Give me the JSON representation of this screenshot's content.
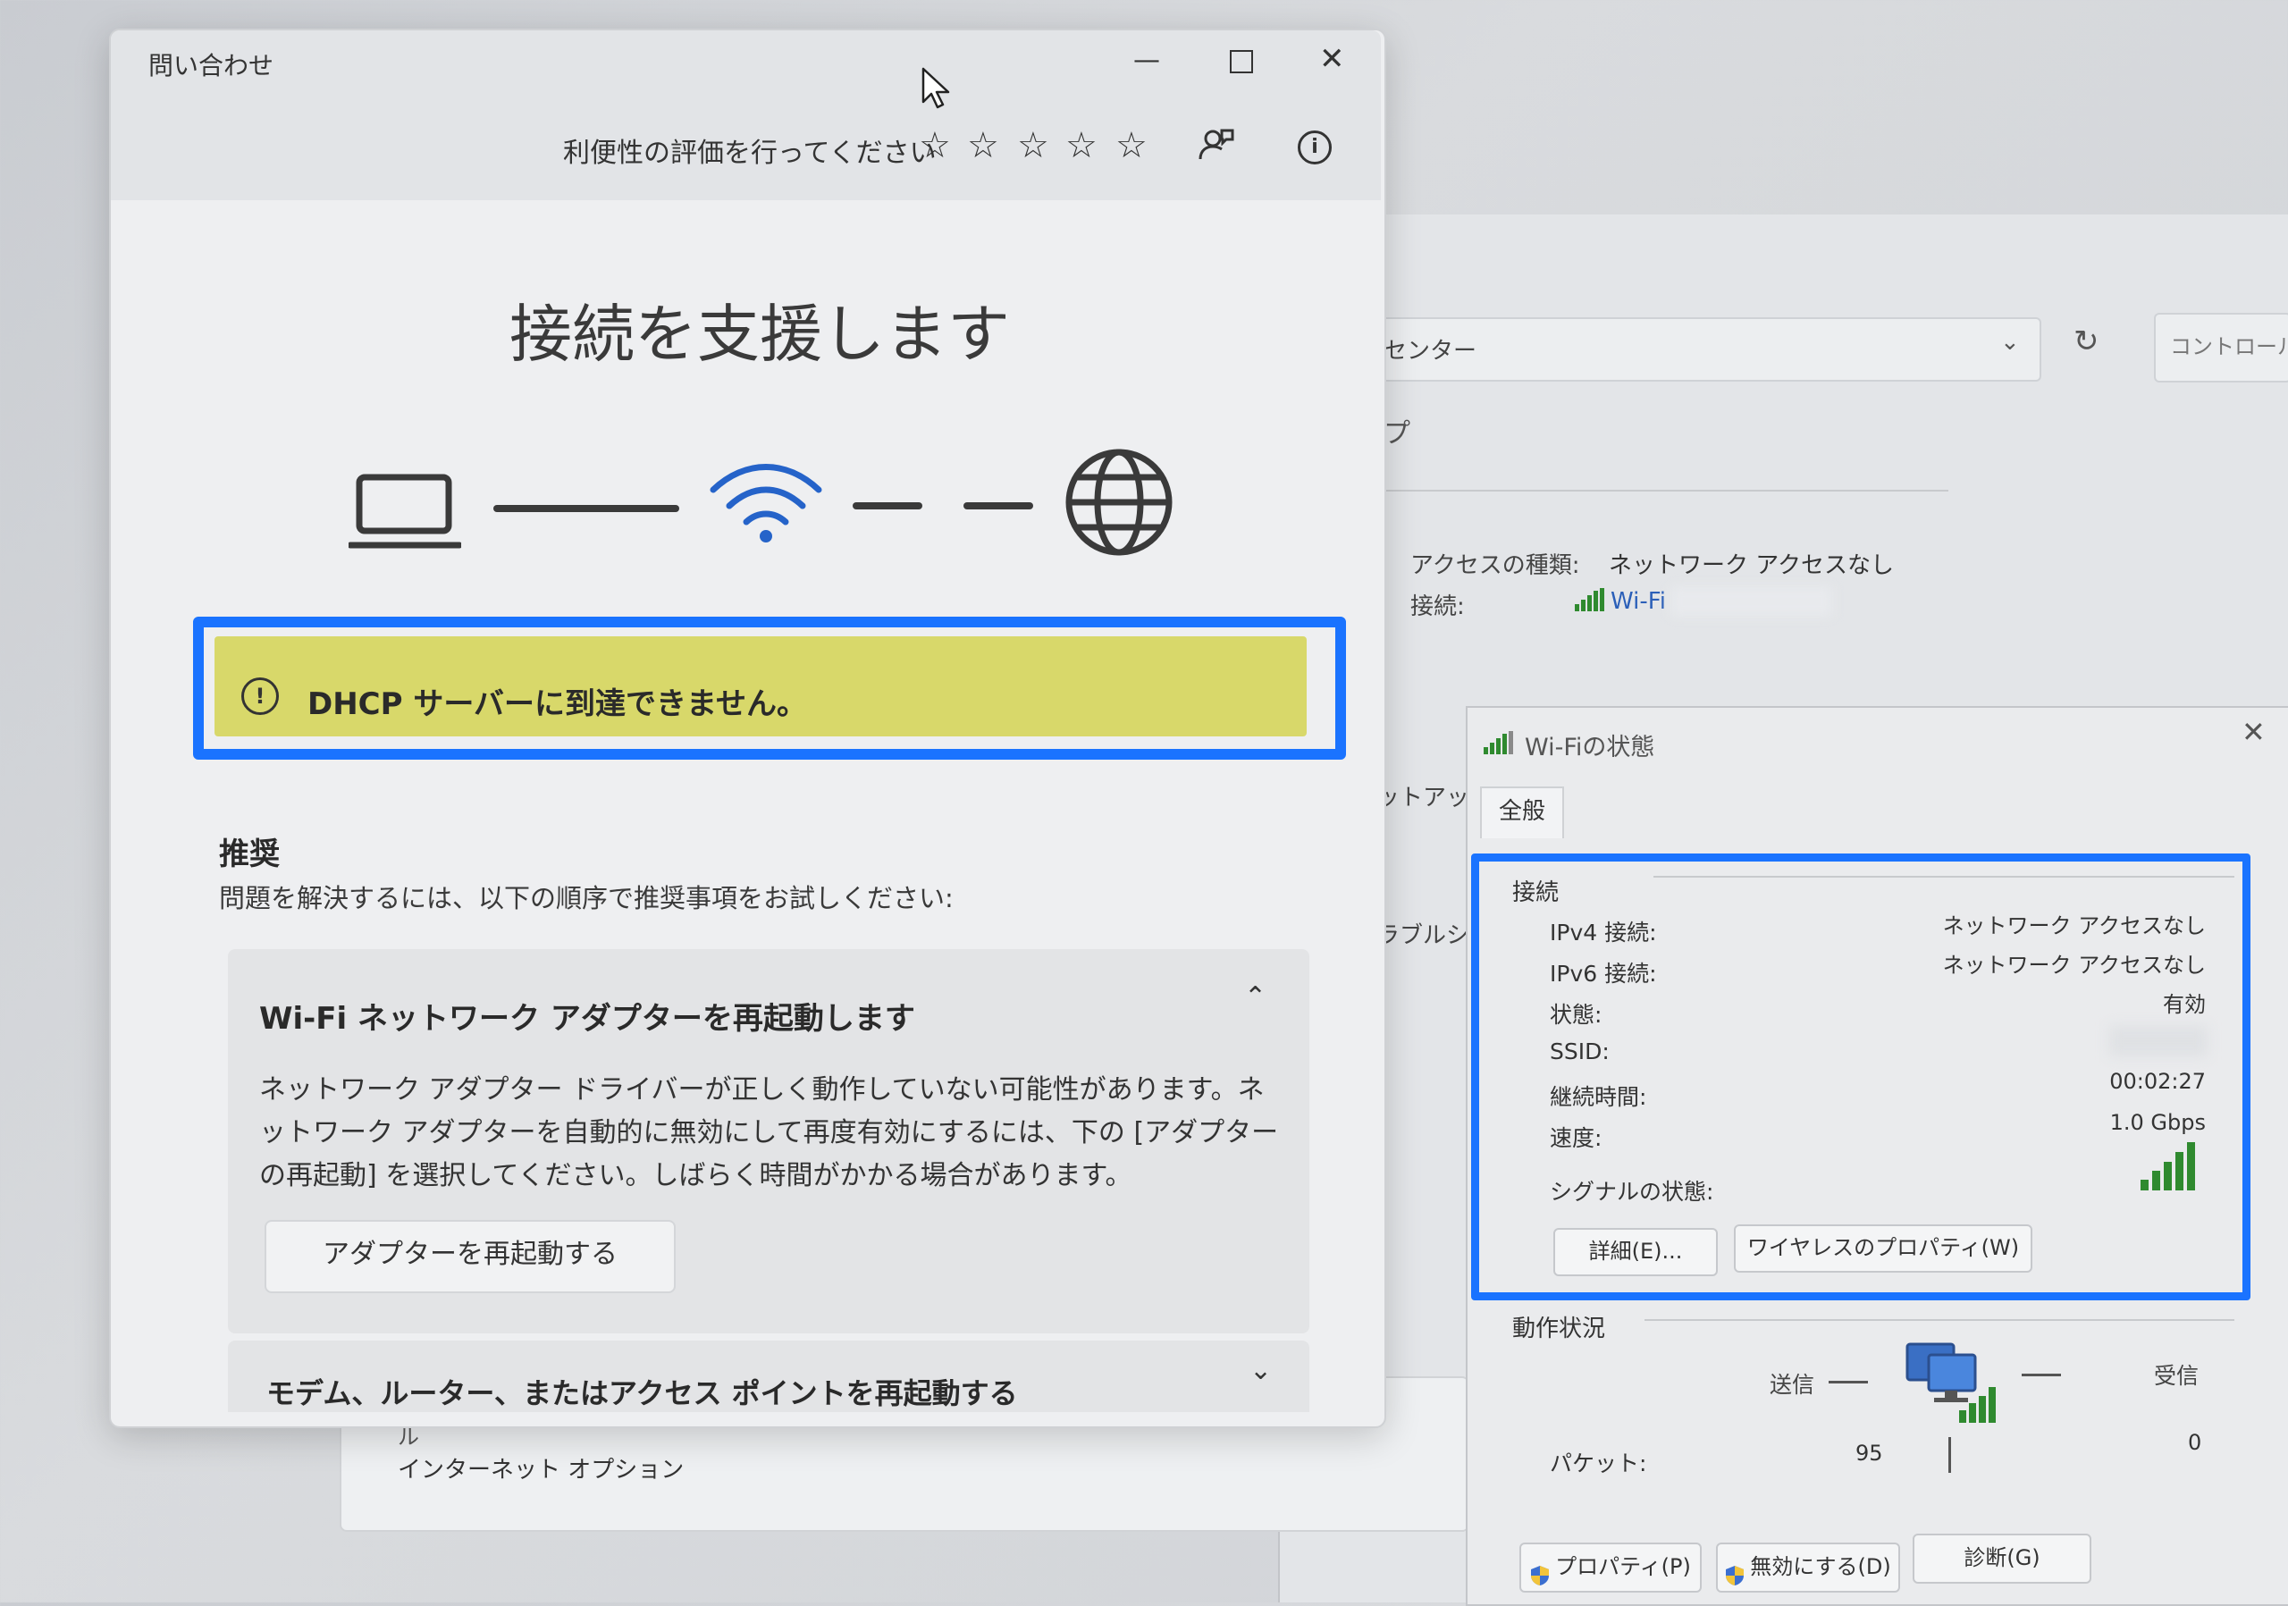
{
  "background_window": {
    "address_text": "センター",
    "search_placeholder": "コントロール パ",
    "heading_fragment": "プ",
    "access_type_label": "アクセスの種類:",
    "access_type_value": "ネットワーク アクセスなし",
    "connection_label": "接続:",
    "connection_value": "Wi-Fi",
    "setup_fragment": "ットアップ",
    "troubleshoot_fragment": "ラブルシュ",
    "lower_fragment": "ル",
    "internet_options": "インターネット オプション"
  },
  "wifi_status": {
    "title": "Wi-Fiの状態",
    "tab": "全般",
    "section_connection": "接続",
    "rows": [
      {
        "label": "IPv4 接続:",
        "value": "ネットワーク アクセスなし"
      },
      {
        "label": "IPv6 接続:",
        "value": "ネットワーク アクセスなし"
      },
      {
        "label": "状態:",
        "value": "有効"
      },
      {
        "label": "SSID:",
        "value": ""
      },
      {
        "label": "継続時間:",
        "value": "00:02:27"
      },
      {
        "label": "速度:",
        "value": "1.0 Gbps"
      },
      {
        "label": "シグナルの状態:",
        "value": ""
      }
    ],
    "details_button": "詳細(E)...",
    "wireless_props_button": "ワイヤレスのプロパティ(W)",
    "section_activity": "動作状況",
    "sent_label": "送信",
    "received_label": "受信",
    "packets_label": "パケット:",
    "packets_sent": "95",
    "packets_received": "0",
    "properties_button": "プロパティ(P)",
    "disable_button": "無効にする(D)",
    "diagnose_button": "診断(G)"
  },
  "get_help": {
    "window_title": "問い合わせ",
    "rating_prompt": "利便性の評価を行ってください",
    "headline": "接続を支援します",
    "error_banner": "DHCP サーバーに到達できません。",
    "recommended_title": "推奨",
    "recommended_desc": "問題を解決するには、以下の順序で推奨事項をお試しください:",
    "card1_title": "Wi-Fi ネットワーク アダプターを再起動します",
    "card1_body": "ネットワーク アダプター ドライバーが正しく動作していない可能性があります。ネットワーク アダプターを自動的に無効にして再度有効にするには、下の [アダプターの再起動] を選択してください。しばらく時間がかかる場合があります。",
    "card1_button": "アダプターを再起動する",
    "card2_title": "モデム、ルーター、またはアクセス ポイントを再起動する"
  },
  "colors": {
    "highlight_outline": "#1a73ff",
    "banner_bg": "#d8d86a",
    "signal_green": "#2f8a2f"
  }
}
